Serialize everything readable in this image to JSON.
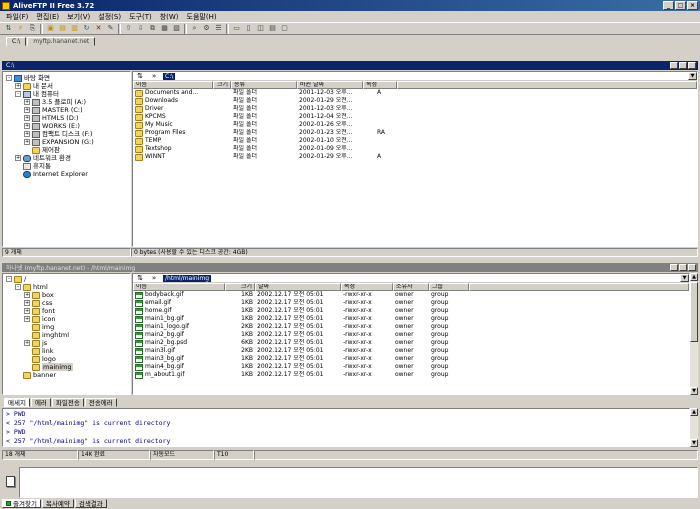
{
  "window": {
    "title": "AliveFTP II Free 3.72"
  },
  "menu": [
    "파일(F)",
    "편집(E)",
    "보기(V)",
    "설정(S)",
    "도구(T)",
    "창(W)",
    "도움말(H)"
  ],
  "connection_tabs": [
    "C:\\",
    "myftp.hananet.net"
  ],
  "local": {
    "panel_title": "C:\\",
    "tree": [
      {
        "label": "바탕 화면",
        "icon": "desktop",
        "expander": "-",
        "indent": 0
      },
      {
        "label": "내 문서",
        "icon": "folder",
        "expander": "+",
        "indent": 1
      },
      {
        "label": "내 컴퓨터",
        "icon": "computer",
        "expander": "-",
        "indent": 1
      },
      {
        "label": "3.5 플로피 (A:)",
        "icon": "drive",
        "expander": "+",
        "indent": 2
      },
      {
        "label": "MASTER (C:)",
        "icon": "drive",
        "expander": "+",
        "indent": 2
      },
      {
        "label": "HTMLS (D:)",
        "icon": "drive",
        "expander": "+",
        "indent": 2
      },
      {
        "label": "WORKS (E:)",
        "icon": "drive",
        "expander": "+",
        "indent": 2
      },
      {
        "label": "컴팩트 디스크 (F:)",
        "icon": "drive",
        "expander": "+",
        "indent": 2
      },
      {
        "label": "EXPANSION (G:)",
        "icon": "drive",
        "expander": "+",
        "indent": 2
      },
      {
        "label": "제어판",
        "icon": "folder",
        "expander": "",
        "indent": 2
      },
      {
        "label": "네트워크 환경",
        "icon": "net",
        "expander": "+",
        "indent": 1
      },
      {
        "label": "휴지통",
        "icon": "trash",
        "expander": "",
        "indent": 1
      },
      {
        "label": "Internet Explorer",
        "icon": "ie",
        "expander": "",
        "indent": 1
      }
    ],
    "address": "C:\\",
    "columns": [
      "이름",
      "크기",
      "종류",
      "바뀐 날짜",
      "속성"
    ],
    "files": [
      {
        "name": "Documents and...",
        "size": "",
        "type": "파일 폴더",
        "date": "2001-12-03 오후...",
        "attr": "A"
      },
      {
        "name": "Downloads",
        "size": "",
        "type": "파일 폴더",
        "date": "2002-01-29 오전...",
        "attr": ""
      },
      {
        "name": "Driver",
        "size": "",
        "type": "파일 폴더",
        "date": "2001-12-03 오후...",
        "attr": ""
      },
      {
        "name": "KPCMS",
        "size": "",
        "type": "파일 폴더",
        "date": "2001-12-04 오전...",
        "attr": ""
      },
      {
        "name": "My Music",
        "size": "",
        "type": "파일 폴더",
        "date": "2002-01-26 오후...",
        "attr": ""
      },
      {
        "name": "Program Files",
        "size": "",
        "type": "파일 폴더",
        "date": "2002-01-23 오전...",
        "attr": "RA"
      },
      {
        "name": "TEMP",
        "size": "",
        "type": "파일 폴더",
        "date": "2002-01-10 오전...",
        "attr": ""
      },
      {
        "name": "Textshop",
        "size": "",
        "type": "파일 폴더",
        "date": "2002-01-09 오후...",
        "attr": ""
      },
      {
        "name": "WINNT",
        "size": "",
        "type": "파일 폴더",
        "date": "2002-01-29 오후...",
        "attr": "A"
      }
    ],
    "status_count": "9 개체",
    "status_info": "0 bytes (사용할 수 있는 디스크 공간: 4GB)"
  },
  "remote": {
    "panel_title": "하나넷 (myftp.hananet.net) - /html/mainimg",
    "tree": [
      {
        "label": "/",
        "expander": "-",
        "indent": 0
      },
      {
        "label": "html",
        "expander": "-",
        "indent": 1
      },
      {
        "label": "box",
        "expander": "+",
        "indent": 2
      },
      {
        "label": "css",
        "expander": "+",
        "indent": 2
      },
      {
        "label": "font",
        "expander": "+",
        "indent": 2
      },
      {
        "label": "icon",
        "expander": "+",
        "indent": 2
      },
      {
        "label": "img",
        "expander": "",
        "indent": 2
      },
      {
        "label": "imghtml",
        "expander": "",
        "indent": 2
      },
      {
        "label": "js",
        "expander": "+",
        "indent": 2
      },
      {
        "label": "link",
        "expander": "",
        "indent": 2
      },
      {
        "label": "logo",
        "expander": "",
        "indent": 2
      },
      {
        "label": "mainimg",
        "expander": "",
        "indent": 2
      },
      {
        "label": "banner",
        "expander": "",
        "indent": 1
      }
    ],
    "address": "/html/mainimg",
    "columns": [
      "이름",
      "크기",
      "날짜",
      "속성",
      "소유자",
      "그룹"
    ],
    "files": [
      {
        "name": "bodyback.gif",
        "size": "1KB",
        "date": "2002.12.17 오전 05:01",
        "attr": "-rwxr-xr-x",
        "owner": "owner",
        "group": "group"
      },
      {
        "name": "email.gif",
        "size": "1KB",
        "date": "2002.12.17 오전 05:01",
        "attr": "-rwxr-xr-x",
        "owner": "owner",
        "group": "group"
      },
      {
        "name": "home.gif",
        "size": "1KB",
        "date": "2002.12.17 오전 05:01",
        "attr": "-rwxr-xr-x",
        "owner": "owner",
        "group": "group"
      },
      {
        "name": "main1_bg.gif",
        "size": "1KB",
        "date": "2002.12.17 오전 05:01",
        "attr": "-rwxr-xr-x",
        "owner": "owner",
        "group": "group"
      },
      {
        "name": "main1_logo.gif",
        "size": "2KB",
        "date": "2002.12.17 오전 05:01",
        "attr": "-rwxr-xr-x",
        "owner": "owner",
        "group": "group"
      },
      {
        "name": "main2_bg.gif",
        "size": "1KB",
        "date": "2002.12.17 오전 05:01",
        "attr": "-rwxr-xr-x",
        "owner": "owner",
        "group": "group"
      },
      {
        "name": "main2_bg.psd",
        "size": "6KB",
        "date": "2002.12.17 오전 05:01",
        "attr": "-rwxr-xr-x",
        "owner": "owner",
        "group": "group"
      },
      {
        "name": "main3l.gif",
        "size": "2KB",
        "date": "2002.12.17 오전 05:01",
        "attr": "-rwxr-xr-x",
        "owner": "owner",
        "group": "group"
      },
      {
        "name": "main3_bg.gif",
        "size": "1KB",
        "date": "2002.12.17 오전 05:01",
        "attr": "-rwxr-xr-x",
        "owner": "owner",
        "group": "group"
      },
      {
        "name": "main4_bg.gif",
        "size": "1KB",
        "date": "2002.12.17 오전 05:01",
        "attr": "-rwxr-xr-x",
        "owner": "owner",
        "group": "group"
      },
      {
        "name": "m_about1.gif",
        "size": "1KB",
        "date": "2002.12.17 오전 05:01",
        "attr": "-rwxr-xr-x",
        "owner": "owner",
        "group": "group"
      }
    ]
  },
  "log_tabs": [
    "메세지",
    "에러",
    "파일전송",
    "전송에러"
  ],
  "log_lines": [
    "> PWD",
    "< 257 \"/html/mainimg\" is current directory",
    "> PWD",
    "< 257 \"/html/mainimg\" is current directory"
  ],
  "status_bar": {
    "count": "18 개체",
    "size": "14K",
    "state": "완료",
    "mode": "자동모드",
    "timer": "T10"
  },
  "bottom_tabs": [
    "즐겨찾기",
    "복사예약",
    "검색결과"
  ]
}
